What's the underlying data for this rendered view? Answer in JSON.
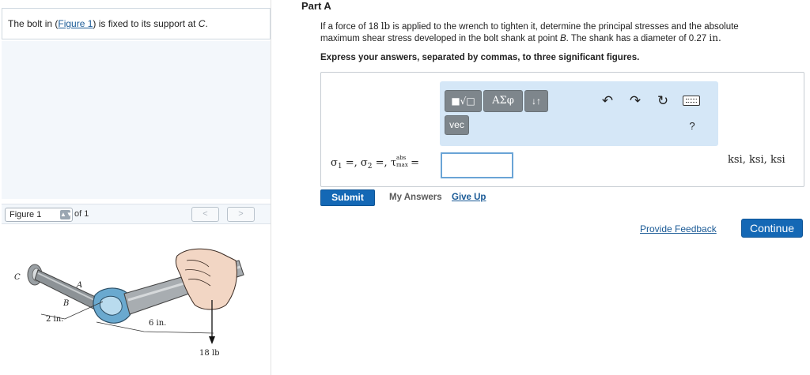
{
  "intro": {
    "before": "The bolt in (",
    "link": "Figure 1",
    "after": ") is fixed to its support at ",
    "point": "C",
    "end": "."
  },
  "figure_nav": {
    "select_value": "Figure 1",
    "of_text": "of 1",
    "prev": "<",
    "next": ">"
  },
  "figure": {
    "label_A": "A",
    "label_B": "B",
    "label_C": "C",
    "dim_2in": "2 in.",
    "dim_6in": "6 in.",
    "force": "18 lb"
  },
  "part": {
    "title": "Part A"
  },
  "problem": {
    "line1_pre": "If a force of 18 ",
    "line1_unit": "lb",
    "line1_post": " is applied to the wrench to tighten it, determine the principal stresses and the absolute",
    "line2_pre": "maximum shear stress developed in the bolt shank at point ",
    "line2_point": "B",
    "line2_mid": ". The shank has a diameter of 0.27 ",
    "line2_unit": "in.",
    "instructions": "Express your answers, separated by commas, to three significant figures."
  },
  "toolbar": {
    "templates": "■√□",
    "greek": "ΑΣφ",
    "arrows": "↓↑",
    "vec": "vec",
    "undo": "↶",
    "redo": "↷",
    "reset": "↻",
    "help": "?"
  },
  "equation": {
    "sigma1": "σ",
    "sub1": "1",
    "sep1": " =, ",
    "sigma2": "σ",
    "sub2": "2",
    "sep2": " =, ",
    "tau": "τ",
    "tau_sub_top": "abs",
    "tau_sub_bottom": "max",
    "eq": " ="
  },
  "units": "ksi, ksi, ksi",
  "actions": {
    "submit": "Submit",
    "my_answers": "My Answers",
    "give_up": "Give Up",
    "feedback": "Provide Feedback",
    "continue": "Continue"
  },
  "colors": {
    "primary_button": "#1468b5",
    "toolbar_bg": "#d5e7f7",
    "link": "#1a5a96"
  }
}
